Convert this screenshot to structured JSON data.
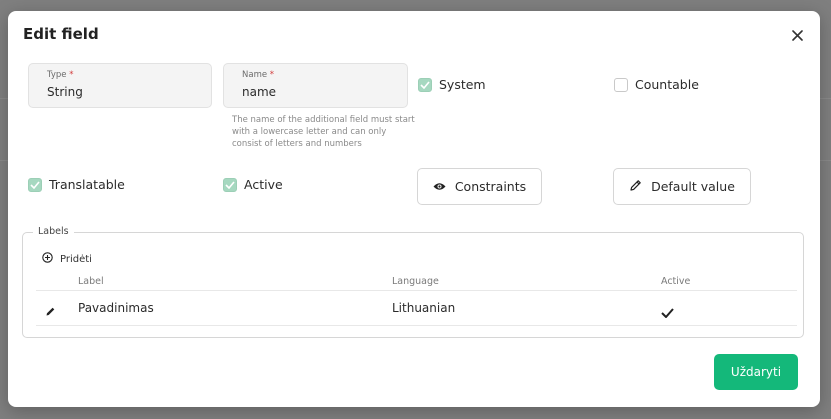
{
  "dialog": {
    "title": "Edit field"
  },
  "fields": {
    "type": {
      "label": "Type",
      "required_mark": "*",
      "value": "String"
    },
    "name": {
      "label": "Name",
      "required_mark": "*",
      "value": "name"
    },
    "name_hint": "The name of the additional field must start with a lowercase letter and can only consist of letters and numbers"
  },
  "checkboxes": {
    "system": {
      "label": "System",
      "checked": true
    },
    "countable": {
      "label": "Countable",
      "checked": false
    },
    "translatable": {
      "label": "Translatable",
      "checked": true
    },
    "active": {
      "label": "Active",
      "checked": true
    }
  },
  "buttons": {
    "constraints": {
      "label": "Constraints",
      "icon": "eye-icon"
    },
    "default_value": {
      "label": "Default value",
      "icon": "pencil-icon"
    },
    "close": {
      "label": "Uždaryti"
    }
  },
  "labels_section": {
    "legend": "Labels",
    "add_label": "Pridėti",
    "columns": [
      "Label",
      "Language",
      "Active"
    ],
    "rows": [
      {
        "label": "Pavadinimas",
        "language": "Lithuanian",
        "active": true
      }
    ]
  },
  "colors": {
    "primary": "#14b87a",
    "checkbox_checked": "#a6d8c0",
    "required": "#d23b3b"
  }
}
